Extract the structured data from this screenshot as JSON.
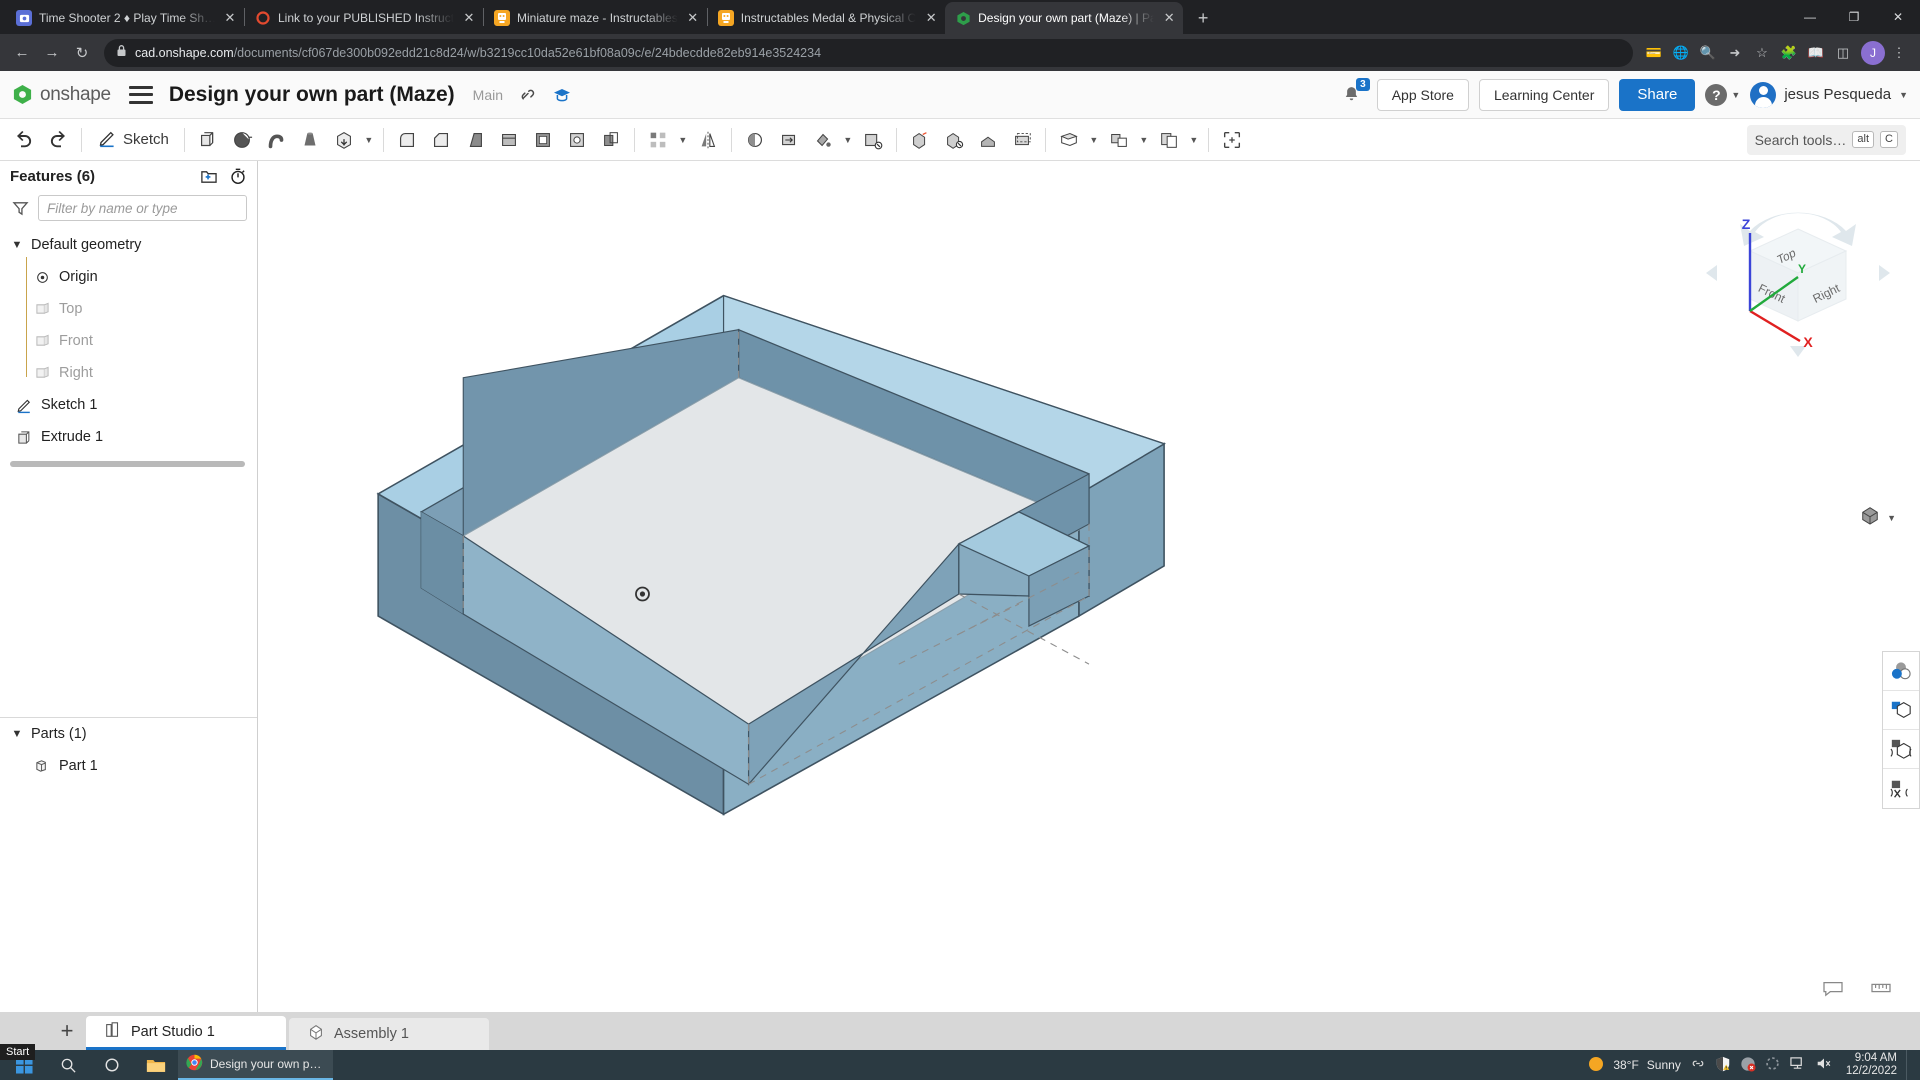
{
  "browser": {
    "tabs": [
      {
        "title": "Time Shooter 2 ♦ Play Time Sh…",
        "favicon": "game-icon",
        "favicon_color": "#5b6fd6",
        "active": false,
        "close_label": "✕"
      },
      {
        "title": "Link to your PUBLISHED Instructa",
        "favicon": "instructables-ring-icon",
        "favicon_color": "#e34a2f",
        "active": false,
        "close_label": "✕"
      },
      {
        "title": "Miniature maze - Instructables",
        "favicon": "instructables-robot-icon",
        "favicon_color": "#f5a623",
        "active": false,
        "close_label": "✕"
      },
      {
        "title": "Instructables Medal & Physical C",
        "favicon": "instructables-robot-icon",
        "favicon_color": "#f5a623",
        "active": false,
        "close_label": "✕"
      },
      {
        "title": "Design your own part (Maze) | Pa",
        "favicon": "onshape-icon",
        "favicon_color": "#2e9e4a",
        "active": true,
        "close_label": "✕"
      }
    ],
    "new_tab_label": "+",
    "window_controls": {
      "minimize": "—",
      "maximize": "❐",
      "close": "✕"
    },
    "nav": {
      "back": "←",
      "forward": "→",
      "reload": "↻"
    },
    "url_domain": "cad.onshape.com",
    "url_path": "/documents/cf067de300b092edd21c8d24/w/b3219cc10da52e61bf08a09c/e/24bdecdde82eb914e3524234",
    "lock_icon": "lock-icon",
    "omni_icons": [
      "payment-icon",
      "translate-icon",
      "zoom-icon",
      "share-icon",
      "bookmark-star-icon",
      "extensions-icon",
      "reading-list-icon",
      "sidepanel-icon"
    ],
    "profile_initial": "J"
  },
  "onshape": {
    "brand": "onshape",
    "document_title": "Design your own part (Maze)",
    "branch": "Main",
    "link_icon": "link-icon",
    "education_icon": "graduation-cap-icon",
    "notification_count": "3",
    "app_store_label": "App Store",
    "learning_center_label": "Learning Center",
    "share_label": "Share",
    "help_label": "?",
    "user_name": "jesus Pesqueda"
  },
  "toolbar": {
    "undo_icon": "undo-icon",
    "redo_icon": "redo-icon",
    "sketch_label": "Sketch",
    "sketch_icon": "pencil-icon",
    "tools": [
      {
        "name": "extrude-tool",
        "icon": "extrude-icon"
      },
      {
        "name": "revolve-tool",
        "icon": "revolve-icon"
      },
      {
        "name": "sweep-tool",
        "icon": "sweep-icon"
      },
      {
        "name": "loft-tool",
        "icon": "loft-icon"
      },
      {
        "name": "thicken-tool",
        "icon": "thicken-icon"
      },
      {
        "name": "fillet-tool",
        "icon": "fillet-icon"
      },
      {
        "name": "chamfer-tool",
        "icon": "chamfer-icon"
      },
      {
        "name": "draft-tool",
        "icon": "draft-icon"
      },
      {
        "name": "rib-tool",
        "icon": "rib-icon"
      },
      {
        "name": "shell-tool",
        "icon": "shell-icon"
      },
      {
        "name": "hole-tool",
        "icon": "hole-icon"
      },
      {
        "name": "boolean-tool",
        "icon": "boolean-icon"
      },
      {
        "name": "pattern-tool",
        "icon": "pattern-icon"
      },
      {
        "name": "mirror-tool",
        "icon": "mirror-icon"
      },
      {
        "name": "split-tool",
        "icon": "split-icon"
      },
      {
        "name": "transform-tool",
        "icon": "transform-icon"
      },
      {
        "name": "delete-face-tool",
        "icon": "delete-face-icon"
      },
      {
        "name": "move-face-tool",
        "icon": "move-face-icon"
      },
      {
        "name": "replace-face-tool",
        "icon": "replace-face-icon"
      },
      {
        "name": "plane-tool",
        "icon": "plane-icon"
      },
      {
        "name": "sketch-plane-tool",
        "icon": "sketch-plane-icon"
      },
      {
        "name": "variable-tool",
        "icon": "variable-icon"
      },
      {
        "name": "measure-tool",
        "icon": "measure-icon"
      }
    ],
    "search_placeholder": "Search tools…",
    "shortcut_alt": "alt",
    "shortcut_key": "C"
  },
  "feature_tree": {
    "title": "Features (6)",
    "add_folder_icon": "add-folder-icon",
    "rollback_icon": "stopwatch-icon",
    "filter_icon": "funnel-icon",
    "filter_placeholder": "Filter by name or type",
    "nodes": [
      {
        "label": "Default geometry",
        "icon": "folder-icon",
        "expanded": true,
        "dim": false,
        "indent": 0
      },
      {
        "label": "Origin",
        "icon": "origin-icon",
        "dim": false,
        "indent": 1
      },
      {
        "label": "Top",
        "icon": "plane-icon",
        "dim": true,
        "indent": 1
      },
      {
        "label": "Front",
        "icon": "plane-icon",
        "dim": true,
        "indent": 1
      },
      {
        "label": "Right",
        "icon": "plane-icon",
        "dim": true,
        "indent": 1
      },
      {
        "label": "Sketch 1",
        "icon": "sketch-icon",
        "dim": false,
        "indent": 0
      },
      {
        "label": "Extrude 1",
        "icon": "extrude-icon",
        "dim": false,
        "indent": 0
      }
    ],
    "parts_title": "Parts (1)",
    "parts": [
      {
        "label": "Part 1",
        "icon": "part-icon"
      }
    ],
    "flyout_icon": "list-panel-icon"
  },
  "viewport": {
    "view_cube": {
      "faces": {
        "top": "Top",
        "front": "Front",
        "right": "Right"
      },
      "axes": {
        "x": "X",
        "y": "Y",
        "z": "Z"
      },
      "axis_colors": {
        "x": "#e02020",
        "y": "#22aa3c",
        "z": "#3b44d8"
      }
    },
    "view_mode_icon": "shaded-cube-icon",
    "model": {
      "name": "maze-tray-part",
      "face_colors": {
        "top_rim": "#a9cfe4",
        "outer_wall": "#7ea2b8",
        "inner_wall": "#6f93a9",
        "floor": "#e3e6e8",
        "edge": "#3f5361"
      }
    },
    "origin_marker_icon": "origin-point-icon",
    "right_tools": [
      {
        "name": "appearance-tool",
        "icon": "color-circles-icon"
      },
      {
        "name": "display-state-tool",
        "icon": "grid-cube-icon"
      },
      {
        "name": "section-tool",
        "icon": "section-cube-icon"
      },
      {
        "name": "render-tool",
        "icon": "render-cube-icon"
      }
    ],
    "bottom_icons": [
      {
        "name": "comment-tool",
        "icon": "speech-bubble-icon"
      },
      {
        "name": "units-tool",
        "icon": "ruler-icon"
      }
    ]
  },
  "studio_tabs": {
    "add_label": "+",
    "tabs": [
      {
        "label": "Part Studio 1",
        "icon": "part-studio-icon",
        "active": true
      },
      {
        "label": "Assembly 1",
        "icon": "assembly-icon",
        "active": false
      }
    ],
    "start_tooltip": "Start"
  },
  "taskbar": {
    "start_icon": "windows-icon",
    "search_icon": "search-icon",
    "cortana_icon": "cortana-icon",
    "explorer_icon": "folder-icon",
    "apps": [
      {
        "label": "Design your own p…",
        "icon": "chrome-icon",
        "active": true
      }
    ],
    "weather_temp": "38°F",
    "weather_desc": "Sunny",
    "weather_icon": "sun-icon",
    "tray_icons": [
      "link-icon",
      "defender-warning-icon",
      "security-alert-icon",
      "sync-icon",
      "network-icon",
      "volume-mute-icon"
    ],
    "time": "9:04 AM",
    "date": "12/2/2022"
  }
}
